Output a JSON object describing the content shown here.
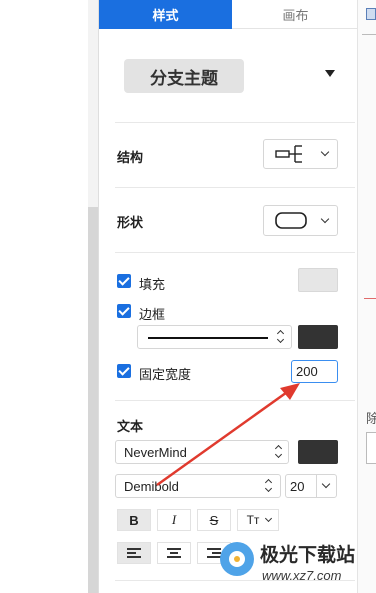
{
  "tabs": [
    {
      "label": "样式",
      "active": true
    },
    {
      "label": "画布",
      "active": false
    }
  ],
  "theme": {
    "label": "分支主题"
  },
  "structure": {
    "label": "结构",
    "icon": "branch-structure-icon"
  },
  "shape": {
    "label": "形状",
    "icon": "rounded-rect-shape-icon"
  },
  "fill": {
    "label": "填充",
    "checked": true,
    "color": "#e6e6e6"
  },
  "border": {
    "label": "边框",
    "checked": true,
    "line_style_icon": "solid-line-icon",
    "color": "#333333"
  },
  "fixed_width": {
    "label": "固定宽度",
    "checked": true,
    "value": "200"
  },
  "text": {
    "label": "文本",
    "font_family": "NeverMind",
    "font_weight": "Demibold",
    "font_size": "20",
    "color": "#333333",
    "format_buttons": [
      {
        "name": "bold",
        "glyph": "B",
        "active": true
      },
      {
        "name": "italic",
        "glyph": "I",
        "active": false
      },
      {
        "name": "strikethrough",
        "glyph": "S",
        "active": false
      },
      {
        "name": "text-case",
        "glyph": "Tт",
        "active": false
      }
    ],
    "align_buttons": [
      {
        "name": "align-left",
        "active": true
      },
      {
        "name": "align-center",
        "active": false
      },
      {
        "name": "align-right",
        "active": false
      }
    ]
  },
  "right_edge_glyph": "除",
  "watermark": {
    "title": "极光下载站",
    "url": "www.xz7.com"
  },
  "colors": {
    "accent": "#1a6fe0",
    "arrow": "#e03a2e"
  }
}
